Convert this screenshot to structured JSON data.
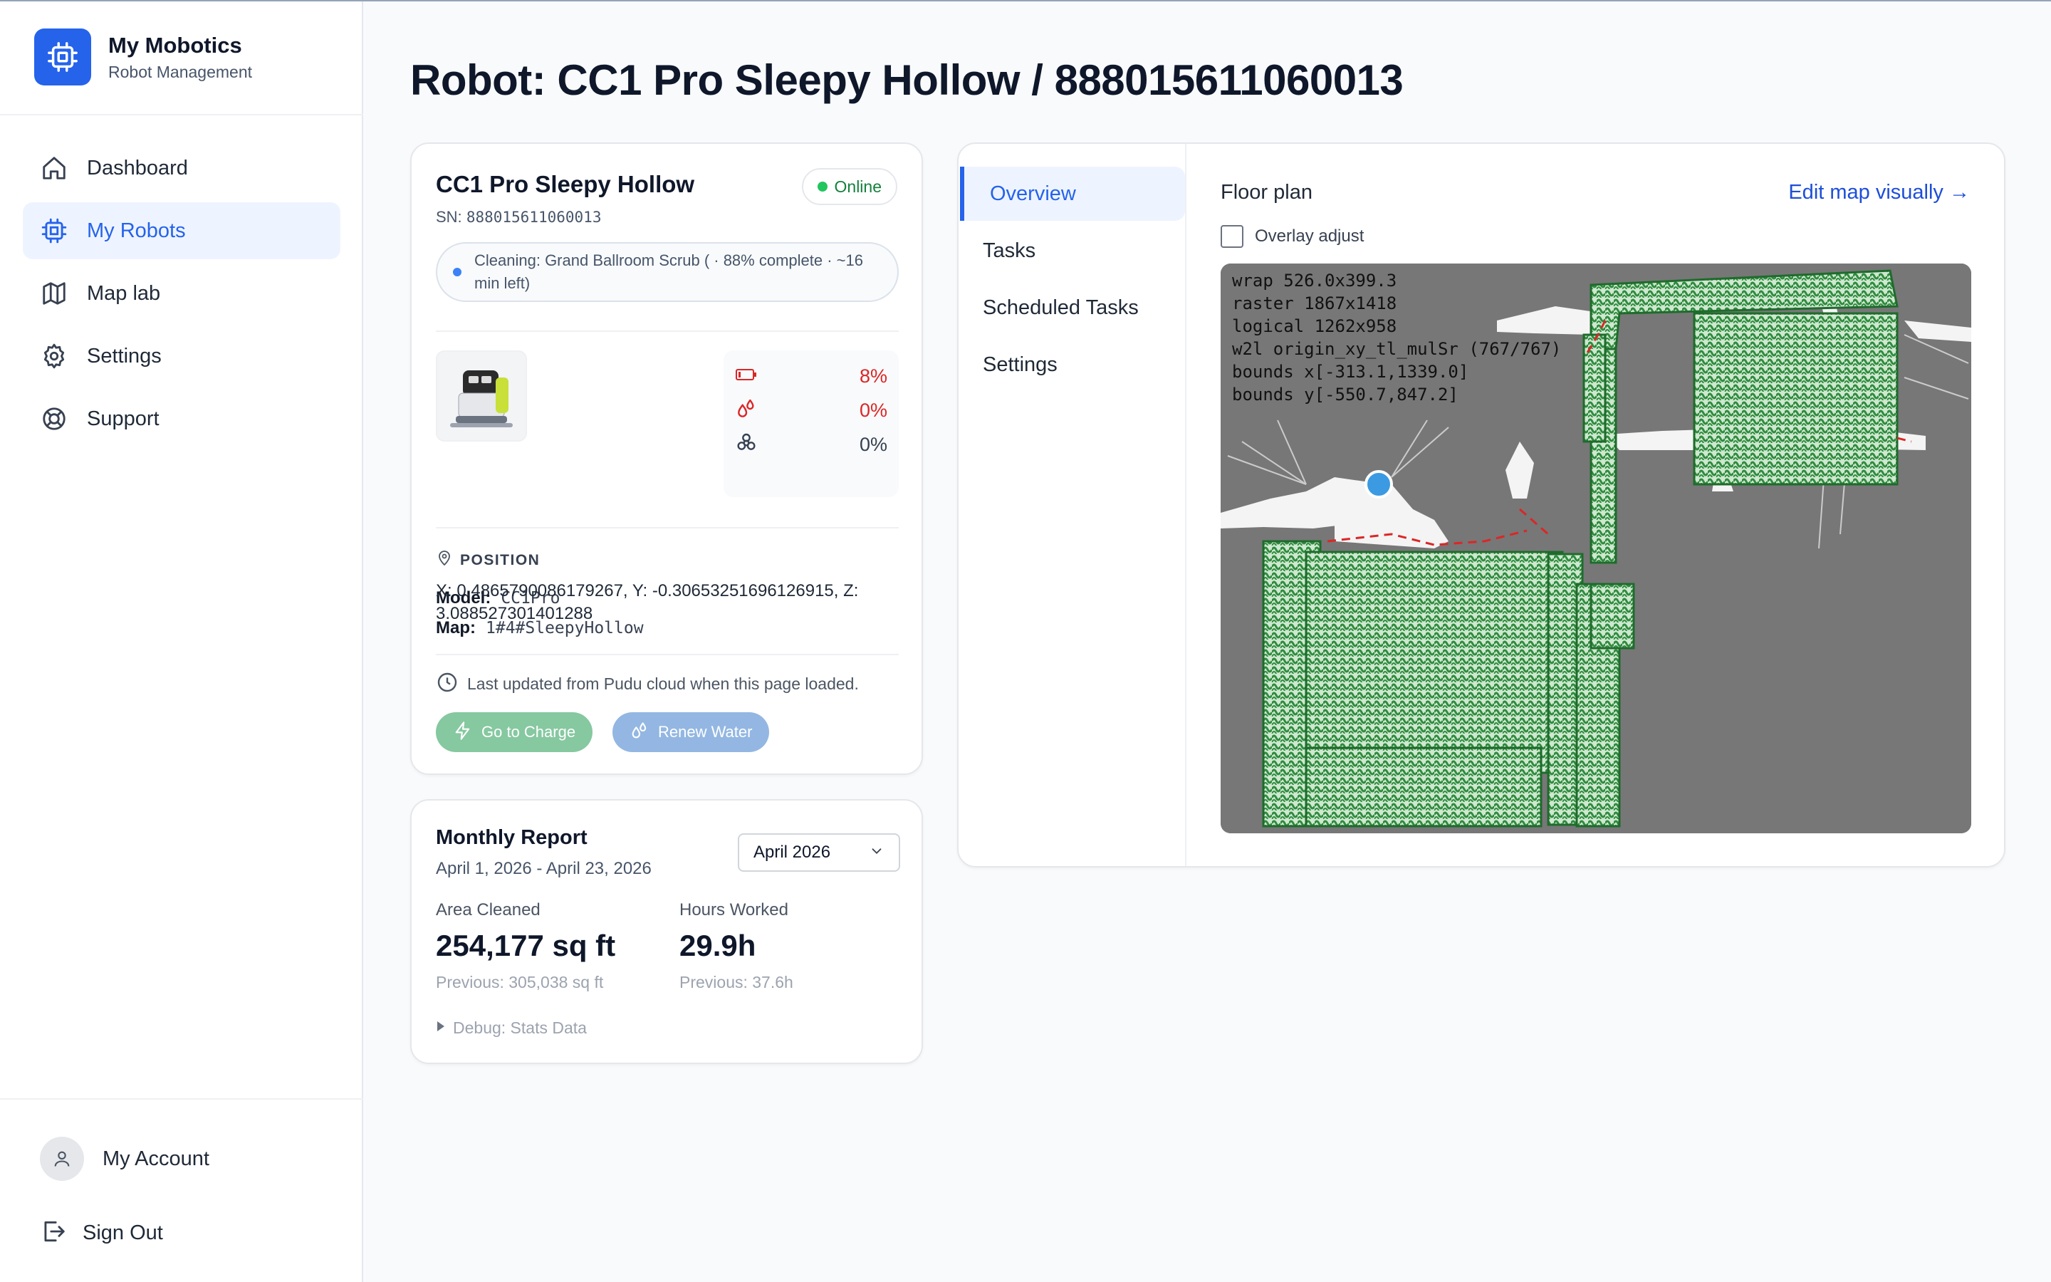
{
  "brand": {
    "title": "My Mobotics",
    "subtitle": "Robot Management"
  },
  "nav": {
    "items": [
      {
        "label": "Dashboard",
        "icon": "home-icon"
      },
      {
        "label": "My Robots",
        "icon": "chip-icon",
        "active": true
      },
      {
        "label": "Map lab",
        "icon": "map-icon"
      },
      {
        "label": "Settings",
        "icon": "gear-icon"
      },
      {
        "label": "Support",
        "icon": "lifebuoy-icon"
      }
    ],
    "account_label": "My Account",
    "signout_label": "Sign Out"
  },
  "page": {
    "title": "Robot: CC1 Pro Sleepy Hollow / 888015611060013"
  },
  "robot": {
    "name": "CC1 Pro Sleepy Hollow",
    "sn_label": "SN:",
    "sn": "888015611060013",
    "status": "Online",
    "status_color": "#22c55e",
    "activity_line1": "Cleaning: Grand Ballroom Scrub ( · 88% complete · ~16",
    "activity_line2": "min left)",
    "model_label": "Model:",
    "model": "CC1Pro",
    "map_label": "Map:",
    "map": "1#4#SleepyHollow",
    "levels": [
      {
        "icon": "battery-icon",
        "value": "8%",
        "color": "#dc2626"
      },
      {
        "icon": "water-drops-icon",
        "value": "0%",
        "color": "#dc2626"
      },
      {
        "icon": "biohazard-icon",
        "value": "0%",
        "color": "#374151"
      }
    ],
    "position_heading": "POSITION",
    "position_line1": "X: 0.4865790086179267, Y: -0.30653251696126915, Z:",
    "position_line2": "3.088527301401288",
    "updated_text": "Last updated from Pudu cloud when this page loaded.",
    "charge_button": "Go to Charge",
    "water_button": "Renew Water"
  },
  "report": {
    "title": "Monthly Report",
    "range": "April 1, 2026 - April 23, 2026",
    "month_selected": "April 2026",
    "area_label": "Area Cleaned",
    "area_value": "254,177 sq ft",
    "area_prev": "Previous: 305,038 sq ft",
    "hours_label": "Hours Worked",
    "hours_value": "29.9h",
    "hours_prev": "Previous: 37.6h",
    "debug_label": "Debug: Stats Data"
  },
  "map_panel": {
    "tabs": [
      "Overview",
      "Tasks",
      "Scheduled Tasks",
      "Settings"
    ],
    "active_tab": "Overview",
    "floor_plan_title": "Floor plan",
    "edit_link": "Edit map visually →",
    "overlay_label": "Overlay adjust",
    "overlay_checked": false,
    "debug_lines": [
      "wrap 526.0x399.3",
      "raster 1867x1418",
      "logical 1262x958",
      "w2l origin_xy_tl_mulSr (767/767)",
      "bounds x[-313.1,1339.0]",
      "bounds y[-550.7,847.2]"
    ]
  },
  "colors": {
    "accent": "#2563eb",
    "cleaned_area": "#2e8b3e",
    "map_background": "#777777",
    "robot_marker": "#3b9ae1",
    "path_dashed": "#dc2626"
  }
}
